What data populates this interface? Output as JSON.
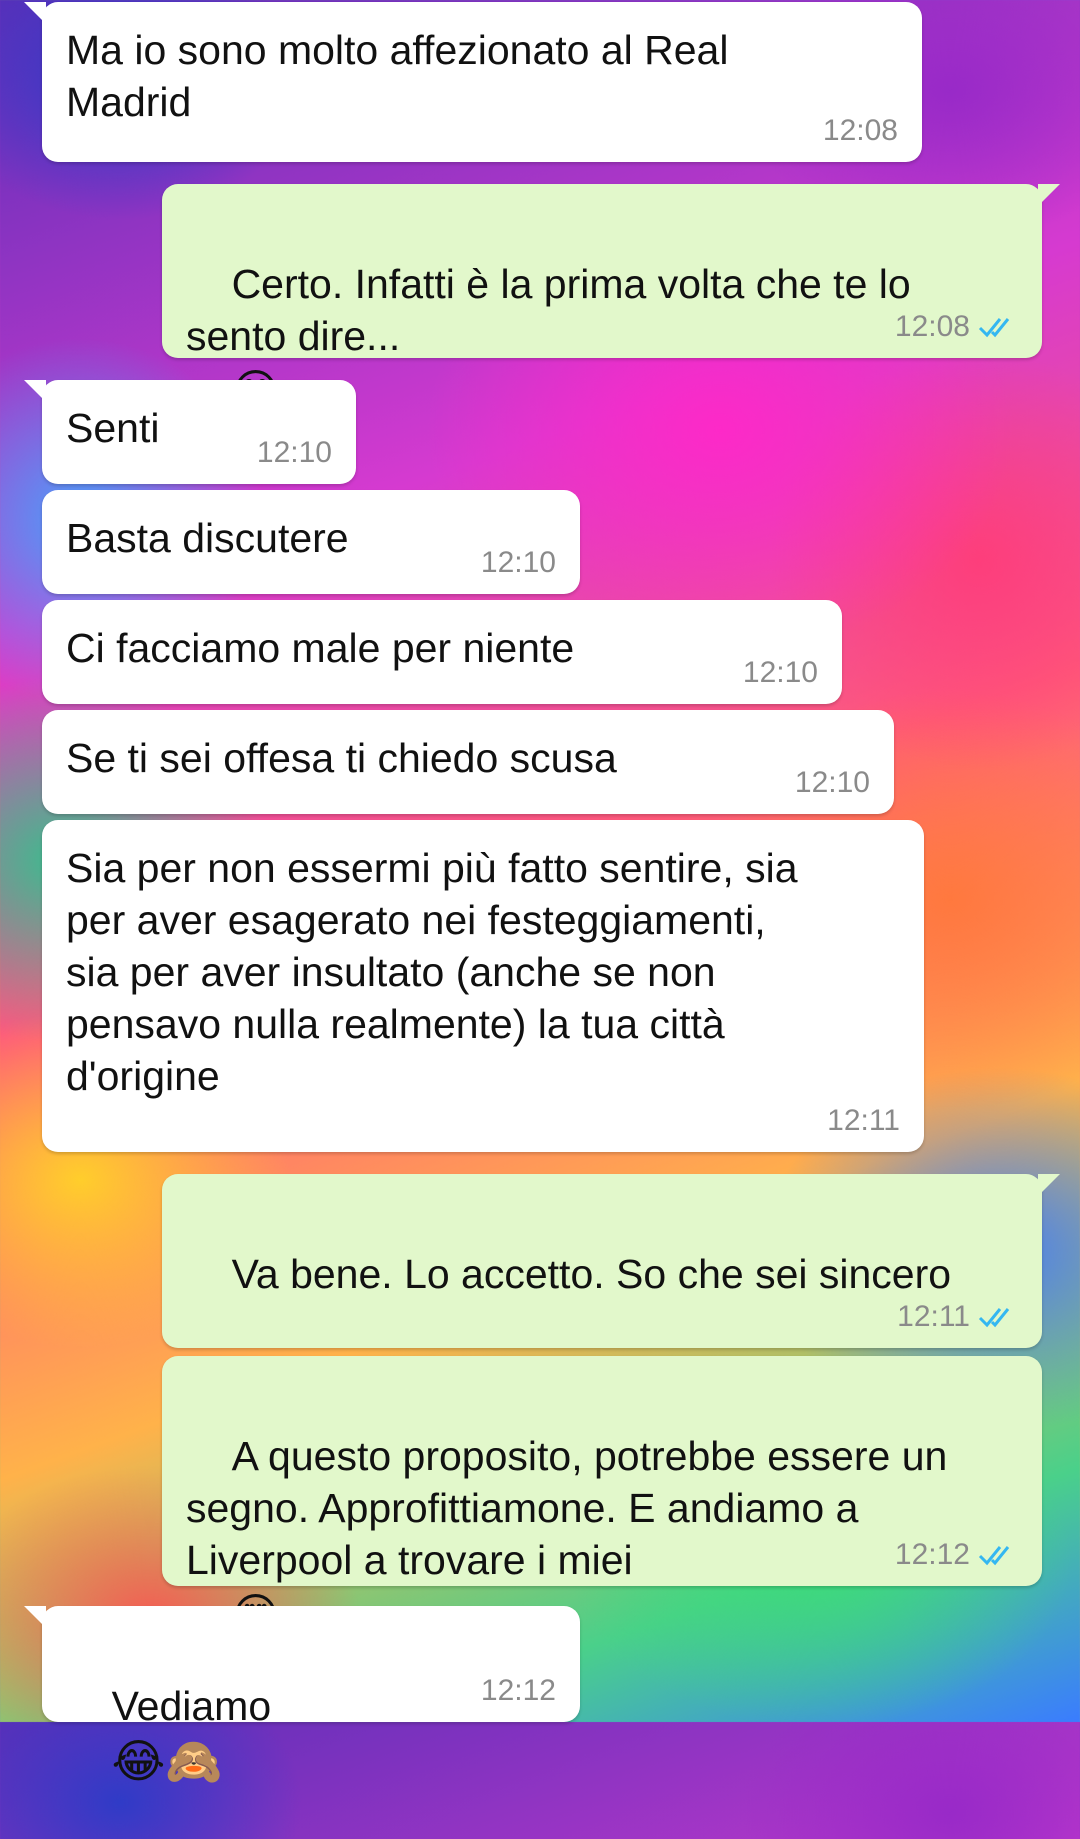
{
  "messages": [
    {
      "direction": "incoming",
      "text": "Ma io sono molto affezionato al Real Madrid",
      "time": "12:08"
    },
    {
      "direction": "outgoing",
      "text": "Certo. Infatti è la prima volta che te lo sento dire...",
      "emoji": "😅",
      "time": "12:08",
      "status": "read"
    },
    {
      "direction": "incoming",
      "text": "Senti",
      "time": "12:10"
    },
    {
      "direction": "incoming",
      "text": "Basta discutere",
      "time": "12:10"
    },
    {
      "direction": "incoming",
      "text": "Ci facciamo male per niente",
      "time": "12:10"
    },
    {
      "direction": "incoming",
      "text": "Se ti sei offesa ti chiedo scusa",
      "time": "12:10"
    },
    {
      "direction": "incoming",
      "text": "Sia per non essermi più fatto sentire, sia per aver esagerato nei festeggiamenti, sia per aver insultato (anche se non pensavo nulla realmente) la tua città d'origine",
      "time": "12:11"
    },
    {
      "direction": "outgoing",
      "text": "Va bene. Lo accetto. So che sei sincero",
      "emoji": "❤️❤️",
      "time": "12:11",
      "status": "read"
    },
    {
      "direction": "outgoing",
      "text": "A questo proposito, potrebbe essere un segno. Approfittiamone. E andiamo a Liverpool a trovare i miei",
      "emoji": "😍",
      "time": "12:12",
      "status": "read"
    },
    {
      "direction": "incoming",
      "text": "Vediamo",
      "emoji": "😂🙈",
      "time": "12:12"
    }
  ],
  "colors": {
    "incoming_bubble": "#ffffff",
    "outgoing_bubble": "#e2f8cb",
    "read_ticks": "#34b7f1",
    "timestamp": "#8a8a8a"
  }
}
